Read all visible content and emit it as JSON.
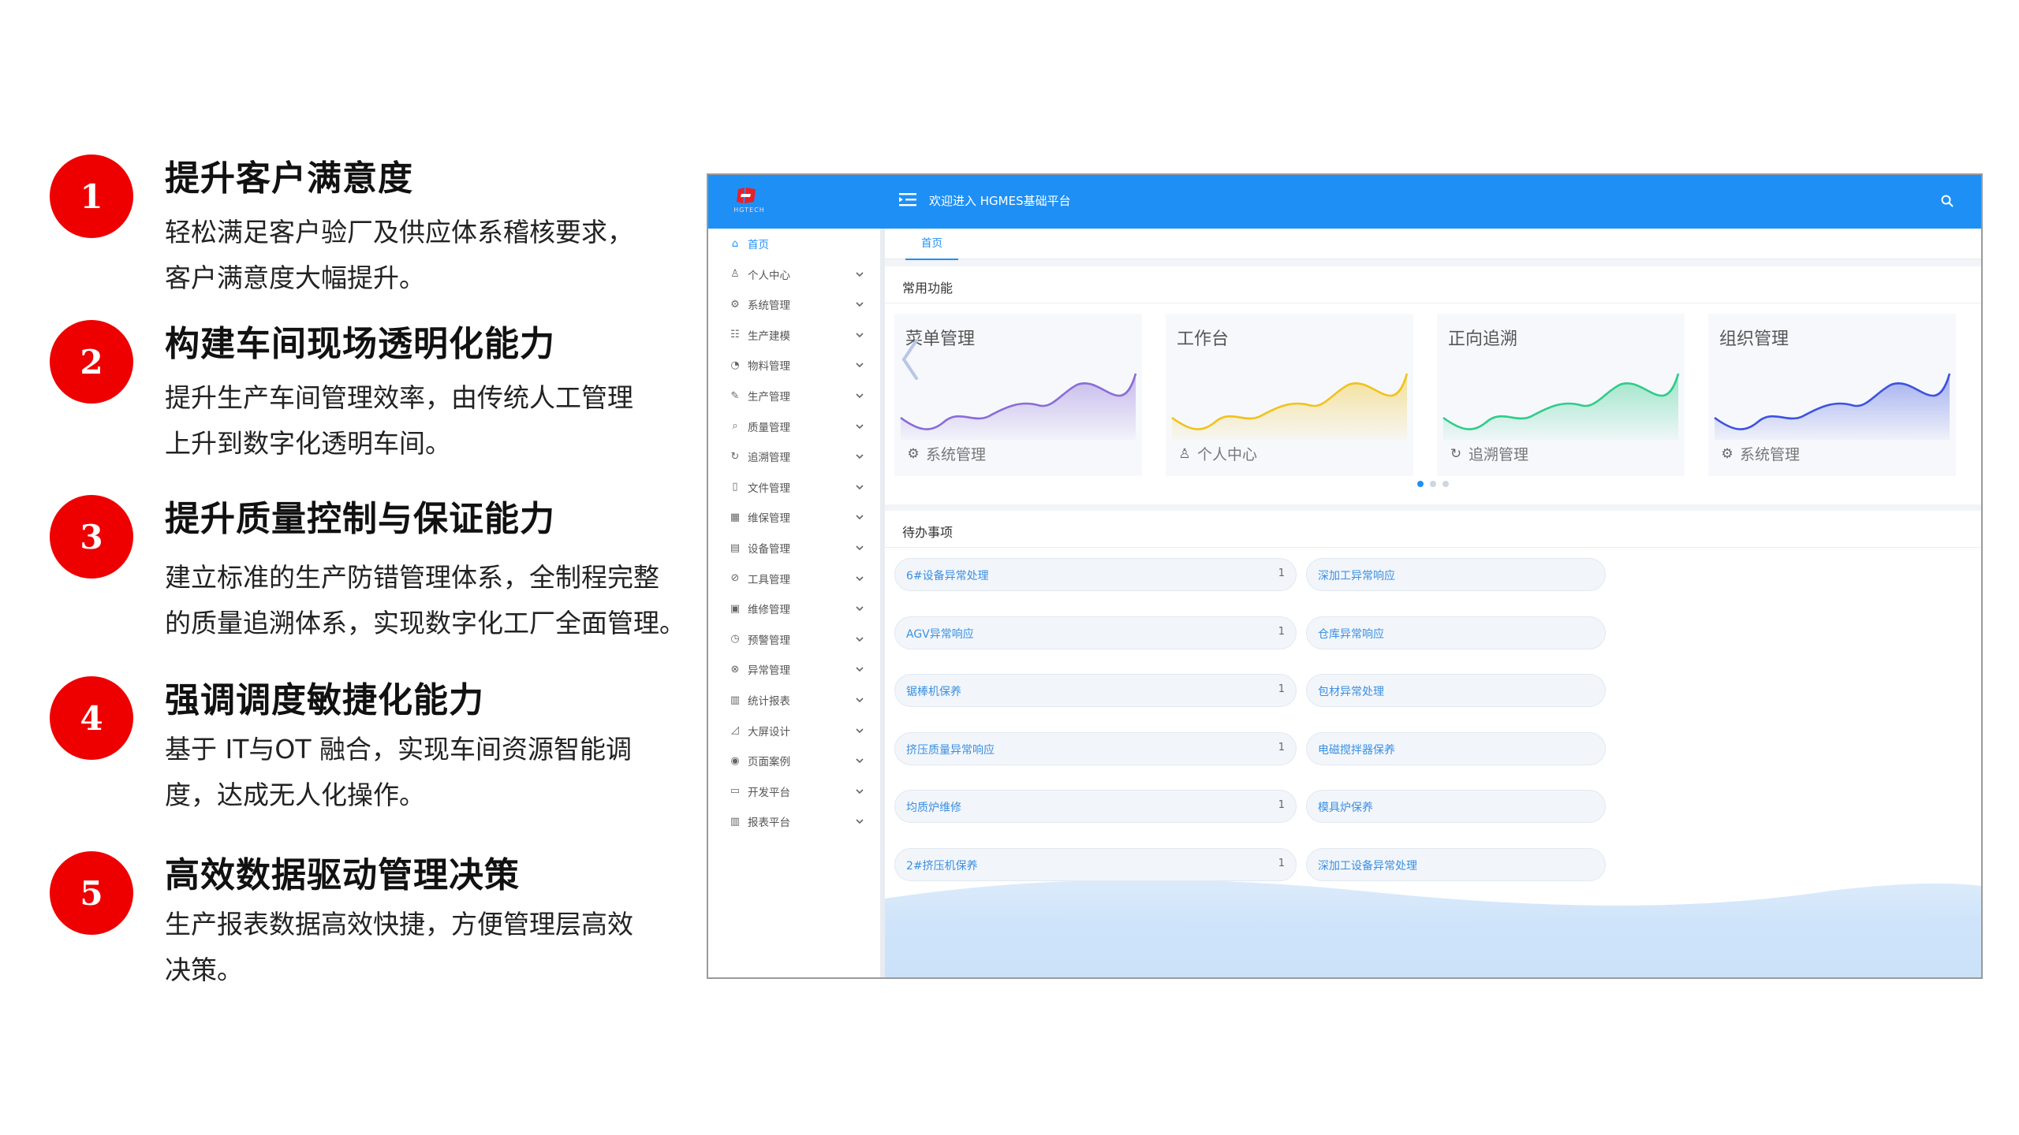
{
  "features": [
    {
      "num": "1",
      "title": "提升客户满意度",
      "desc": "轻松满足客户验厂及供应体系稽核要求，\n客户满意度大幅提升。"
    },
    {
      "num": "2",
      "title": "构建车间现场透明化能力",
      "desc": "提升生产车间管理效率，由传统人工管理\n上升到数字化透明车间。"
    },
    {
      "num": "3",
      "title": "提升质量控制与保证能力",
      "desc": "建立标准的生产防错管理体系，全制程完整\n的质量追溯体系，实现数字化工厂全面管理。"
    },
    {
      "num": "4",
      "title": "强调调度敏捷化能力",
      "desc": "基于 IT与OT 融合，实现车间资源智能调\n度，达成无人化操作。"
    },
    {
      "num": "5",
      "title": "高效数据驱动管理决策",
      "desc": "生产报表数据高效快捷，方便管理层高效\n决策。"
    }
  ],
  "app": {
    "logo_text": "HGTECH",
    "top_title": "欢迎进入 HGMES基础平台",
    "sidebar": [
      {
        "label": "首页",
        "icon": "home-icon",
        "glyph": "⌂"
      },
      {
        "label": "个人中心",
        "icon": "user-icon",
        "glyph": "♙"
      },
      {
        "label": "系统管理",
        "icon": "gear-icon",
        "glyph": "⚙"
      },
      {
        "label": "生产建模",
        "icon": "org-chart-icon",
        "glyph": "☷"
      },
      {
        "label": "物料管理",
        "icon": "box-icon",
        "glyph": "◔"
      },
      {
        "label": "生产管理",
        "icon": "wrench-icon",
        "glyph": "✎"
      },
      {
        "label": "质量管理",
        "icon": "magnifier-icon",
        "glyph": "⌕"
      },
      {
        "label": "追溯管理",
        "icon": "refresh-icon",
        "glyph": "↻"
      },
      {
        "label": "文件管理",
        "icon": "file-icon",
        "glyph": "▯"
      },
      {
        "label": "维保管理",
        "icon": "maintenance-icon",
        "glyph": "▦"
      },
      {
        "label": "设备管理",
        "icon": "equipment-icon",
        "glyph": "▤"
      },
      {
        "label": "工具管理",
        "icon": "tool-icon",
        "glyph": "⊘"
      },
      {
        "label": "维修管理",
        "icon": "repair-icon",
        "glyph": "▣"
      },
      {
        "label": "预警管理",
        "icon": "warning-icon",
        "glyph": "◷"
      },
      {
        "label": "异常管理",
        "icon": "exception-icon",
        "glyph": "⊗"
      },
      {
        "label": "统计报表",
        "icon": "bar-chart-icon",
        "glyph": "▥"
      },
      {
        "label": "大屏设计",
        "icon": "line-chart-icon",
        "glyph": "◿"
      },
      {
        "label": "页面案例",
        "icon": "eye-icon",
        "glyph": "◉"
      },
      {
        "label": "开发平台",
        "icon": "monitor-icon",
        "glyph": "▭"
      },
      {
        "label": "报表平台",
        "icon": "report-icon",
        "glyph": "▥"
      }
    ],
    "tab": "首页",
    "common_title": "常用功能",
    "cards": [
      {
        "title": "菜单管理",
        "foot": "系统管理",
        "foot_icon": "gear-icon",
        "glyph": "⚙",
        "color": "#8a6cd8"
      },
      {
        "title": "工作台",
        "foot": "个人中心",
        "foot_icon": "user-icon",
        "glyph": "♙",
        "color": "#f1c21b"
      },
      {
        "title": "正向追溯",
        "foot": "追溯管理",
        "foot_icon": "refresh-icon",
        "glyph": "↻",
        "color": "#2ecc8a"
      },
      {
        "title": "组织管理",
        "foot": "系统管理",
        "foot_icon": "gear-icon",
        "glyph": "⚙",
        "color": "#3c52e0"
      }
    ],
    "todo_title": "待办事项",
    "todos_left": [
      {
        "label": "6#设备异常处理",
        "count": "1"
      },
      {
        "label": "AGV异常响应",
        "count": "1"
      },
      {
        "label": "锯棒机保养",
        "count": "1"
      },
      {
        "label": "挤压质量异常响应",
        "count": "1"
      },
      {
        "label": "均质炉维修",
        "count": "1"
      },
      {
        "label": "2#挤压机保养",
        "count": "1"
      }
    ],
    "todos_right": [
      {
        "label": "深加工异常响应"
      },
      {
        "label": "仓库异常响应"
      },
      {
        "label": "包材异常处理"
      },
      {
        "label": "电磁搅拌器保养"
      },
      {
        "label": "模具炉保养"
      },
      {
        "label": "深加工设备异常处理"
      }
    ]
  }
}
